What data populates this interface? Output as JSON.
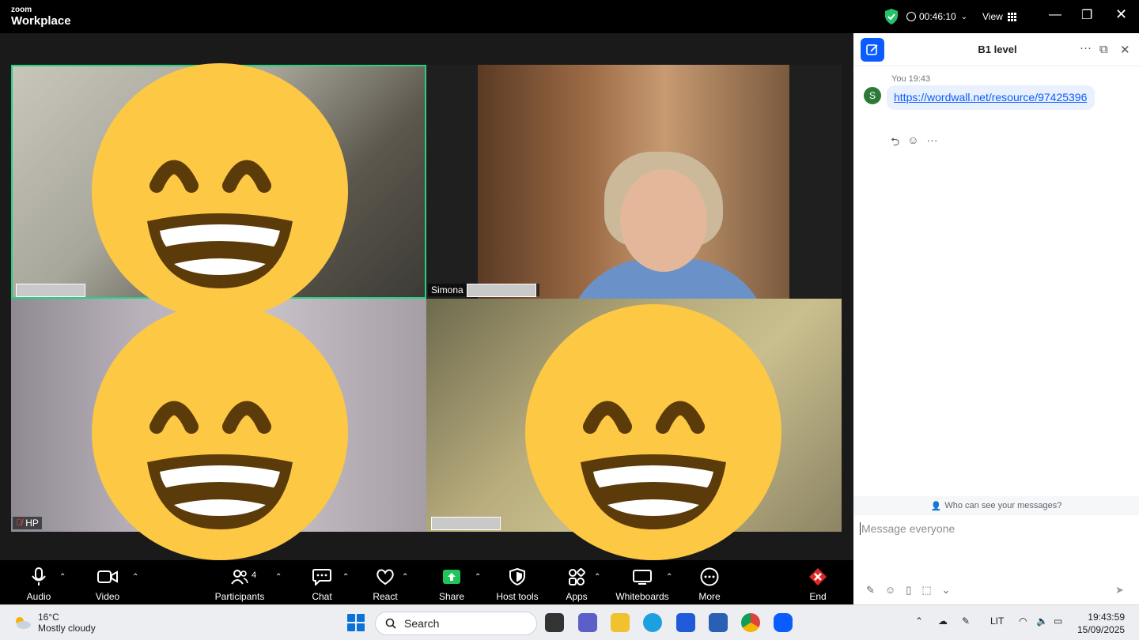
{
  "topbar": {
    "brand_line1": "zoom",
    "brand_line2": "Workplace",
    "timer": "00:46:10",
    "view_label": "View"
  },
  "participants": [
    {
      "name": "",
      "active": true
    },
    {
      "name": "Simona",
      "active": false
    },
    {
      "name": "HP",
      "muted": true,
      "active": false
    },
    {
      "name": "",
      "active": false
    }
  ],
  "toolbar": {
    "audio": "Audio",
    "video": "Video",
    "participants": "Participants",
    "participants_count": "4",
    "chat": "Chat",
    "react": "React",
    "share": "Share",
    "host_tools": "Host tools",
    "apps": "Apps",
    "whiteboards": "Whiteboards",
    "more": "More",
    "end": "End"
  },
  "chat": {
    "title": "B1 level",
    "sender": "You",
    "time": "19:43",
    "avatar_letter": "S",
    "message": "https://wordwall.net/resource/97425396",
    "who_can_see": "Who can see your messages?",
    "placeholder": "Message everyone"
  },
  "taskbar": {
    "temperature": "16°C",
    "weather": "Mostly cloudy",
    "search": "Search",
    "language": "LIT",
    "time": "19:43:59",
    "date": "15/09/2025"
  },
  "colors": {
    "active_speaker": "#27d17f",
    "zoom_blue": "#0b5cff",
    "emoji_yellow": "#fdc844",
    "end_red": "#e02828"
  }
}
